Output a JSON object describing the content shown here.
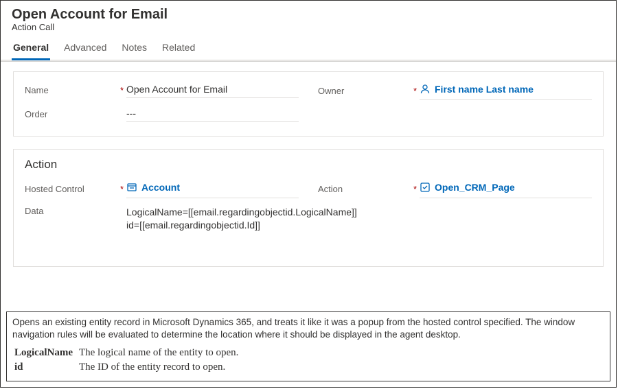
{
  "header": {
    "title": "Open Account for Email",
    "subtitle": "Action Call"
  },
  "tabs": [
    {
      "label": "General",
      "active": true
    },
    {
      "label": "Advanced",
      "active": false
    },
    {
      "label": "Notes",
      "active": false
    },
    {
      "label": "Related",
      "active": false
    }
  ],
  "general": {
    "name": {
      "label": "Name",
      "required": true,
      "value": "Open Account for Email"
    },
    "owner": {
      "label": "Owner",
      "required": true,
      "value": "First name Last name"
    },
    "order": {
      "label": "Order",
      "required": false,
      "value": "---"
    }
  },
  "action": {
    "section_title": "Action",
    "hosted_control": {
      "label": "Hosted Control",
      "required": true,
      "value": "Account"
    },
    "action": {
      "label": "Action",
      "required": true,
      "value": "Open_CRM_Page"
    },
    "data": {
      "label": "Data",
      "required": false,
      "value": "LogicalName=[[email.regardingobjectid.LogicalName]]\nid=[[email.regardingobjectid.Id]]"
    }
  },
  "description": {
    "body": "Opens an existing entity record in Microsoft Dynamics 365, and treats it like it was a popup from the hosted control specified.   The window navigation rules will be evaluated to determine the location where it should be displayed in the agent desktop.",
    "params": [
      {
        "name": "LogicalName",
        "desc": "The logical name of the entity to open."
      },
      {
        "name": "id",
        "desc": "The ID of the entity record to open."
      }
    ]
  },
  "req_mark": "*"
}
